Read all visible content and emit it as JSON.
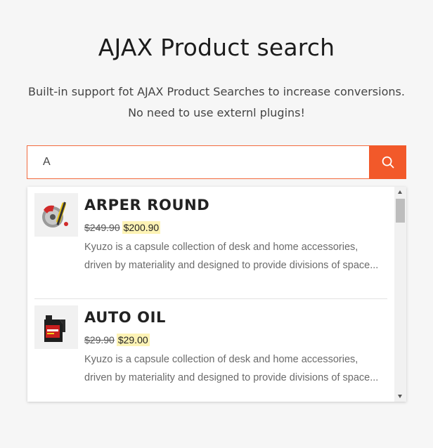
{
  "header": {
    "title": "AJAX Product search",
    "subtitle_line1": "Built-in support fot AJAX Product Searches to increase conversions.",
    "subtitle_line2": "No need to use externl plugins!"
  },
  "search": {
    "value": "A",
    "placeholder": "",
    "button_icon": "search-icon"
  },
  "colors": {
    "accent": "#f2592a",
    "highlight": "#fdf3b5"
  },
  "results": [
    {
      "name": "ARPER ROUND",
      "old_price": "$249.90",
      "new_price": "$200.90",
      "description": "Kyuzo is a capsule collection of desk and home accessories, driven by materiality and designed to provide divisions of space...",
      "thumb_icon": "brake-caliper-icon"
    },
    {
      "name": "AUTO OIL",
      "old_price": "$29.90",
      "new_price": "$29.00",
      "description": "Kyuzo is a capsule collection of desk and home accessories, driven by materiality and designed to provide divisions of space...",
      "thumb_icon": "oil-bottle-icon"
    }
  ]
}
